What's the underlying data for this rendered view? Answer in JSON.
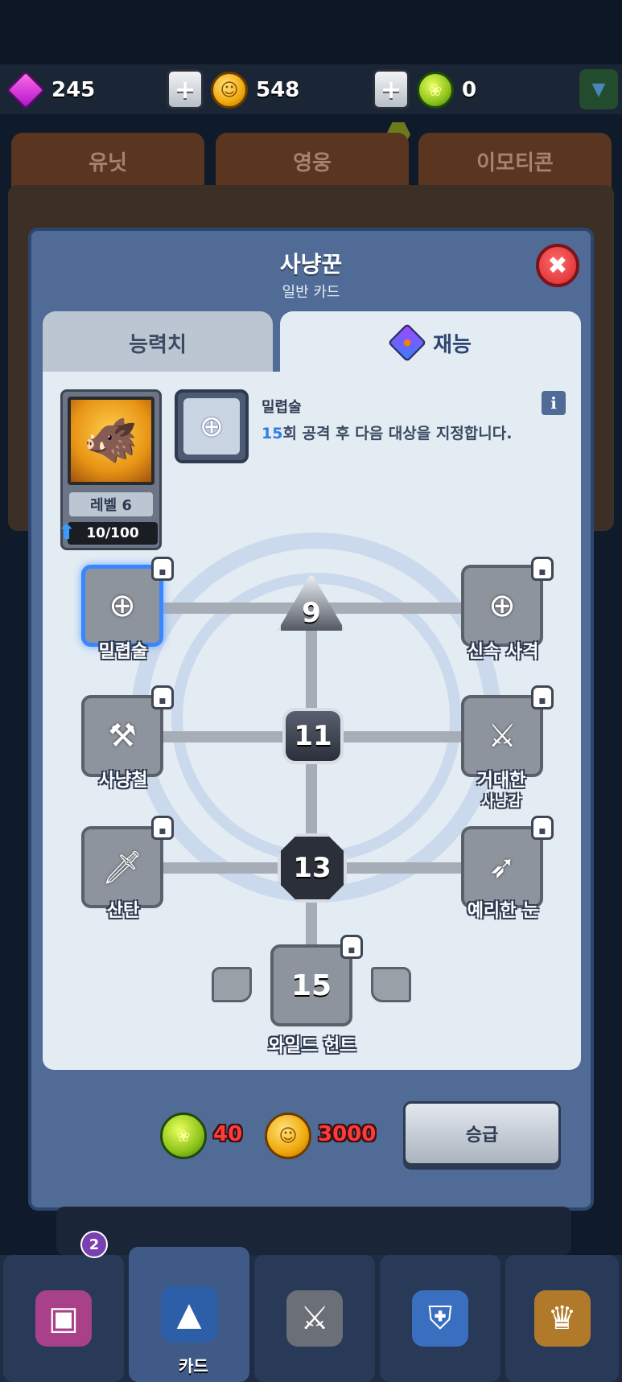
{
  "currency": {
    "gems": "245",
    "coins": "548",
    "leaves": "0",
    "plus_symbol": "+"
  },
  "bg_tabs": [
    "유닛",
    "영웅",
    "이모티콘"
  ],
  "modal": {
    "title": "사냥꾼",
    "subtitle": "일반 카드",
    "close_symbol": "✖",
    "tabs": {
      "stats": "능력치",
      "talent": "재능"
    }
  },
  "hero": {
    "level_label": "레벨 6",
    "xp": "10/100"
  },
  "ability": {
    "name": "밀렵술",
    "desc_count": "15",
    "desc_rest": "회 공격 후 다음 대상을 지정합니다.",
    "info_symbol": "i"
  },
  "talents": {
    "levels": [
      "9",
      "11",
      "13",
      "15"
    ],
    "nodes": {
      "poaching": "밀렵술",
      "quick_shot": "신속 사격",
      "hunting_iron": "사냥철",
      "giant_hunt_line1": "거대한",
      "giant_hunt_line2": "사냥감",
      "scatter": "산탄",
      "sharp_eye": "예리한 눈",
      "wild_hunt": "와일드 헌트"
    }
  },
  "upgrade": {
    "leaf_cost": "40",
    "coin_cost": "3000",
    "button_label": "승급"
  },
  "bottom_nav": {
    "active_label": "카드",
    "badge": "2"
  },
  "colors": {
    "modal_bg": "#4f6b96",
    "panel_bg": "#e3ebf3",
    "cost_red": "#ff3a3a",
    "desc_blue": "#2f7ee0",
    "selected_blue": "#3a86ff"
  },
  "icons": {
    "gem": "purple-gem-icon",
    "coin": "gold-coin-icon",
    "leaf": "green-leaf-icon",
    "close": "close-icon",
    "info": "info-icon",
    "lock": "lock-icon",
    "xp_arrow": "arrow-up-icon"
  }
}
